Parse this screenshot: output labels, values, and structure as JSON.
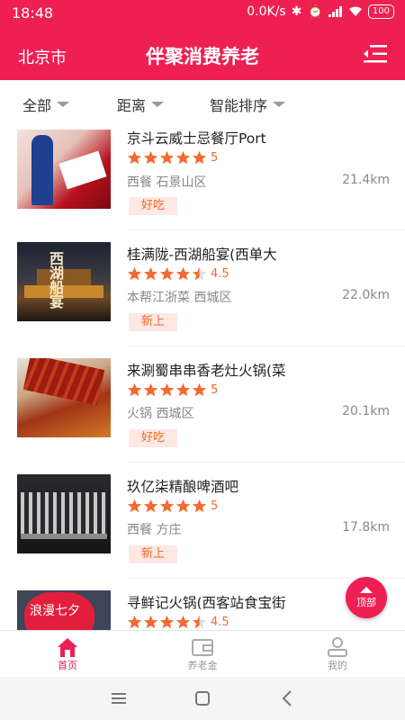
{
  "status_bar": {
    "time": "18:48",
    "speed": "0.0K/s",
    "battery": "100"
  },
  "header": {
    "city": "北京市",
    "title": "伴聚消费养老"
  },
  "filters": [
    "全部",
    "距离",
    "智能排序"
  ],
  "restaurants": [
    {
      "name": "京斗云威士忌餐厅Port",
      "stars": 5,
      "rating": "5",
      "info": "西餐 石景山区",
      "distance": "21.4km",
      "tag": "好吃"
    },
    {
      "name": "桂满陇-西湖船宴(西单大",
      "stars": 4.5,
      "rating": "4.5",
      "info": "本帮江浙菜 西城区",
      "distance": "22.0km",
      "tag": "新上",
      "thumb_text": "西湖船宴"
    },
    {
      "name": "来涮蜀串串香老灶火锅(菜",
      "stars": 5,
      "rating": "5",
      "info": "火锅 西城区",
      "distance": "20.1km",
      "tag": "好吃"
    },
    {
      "name": "玖亿柒精酿啤酒吧",
      "stars": 5,
      "rating": "5",
      "info": "西餐 方庄",
      "distance": "17.8km",
      "tag": "新上"
    },
    {
      "name": "寻鲜记火锅(西客站食宝街",
      "stars": 4.5,
      "rating": "4.5",
      "info": "",
      "distance": "",
      "tag": "",
      "thumb_text": "浪漫七夕"
    }
  ],
  "back_to_top": "顶部",
  "tabs": [
    {
      "label": "首页"
    },
    {
      "label": "养老金"
    },
    {
      "label": "我的"
    }
  ],
  "colors": {
    "brand": "#ee1f52",
    "star": "#f36a2c",
    "tag_bg": "#fde8e4"
  }
}
